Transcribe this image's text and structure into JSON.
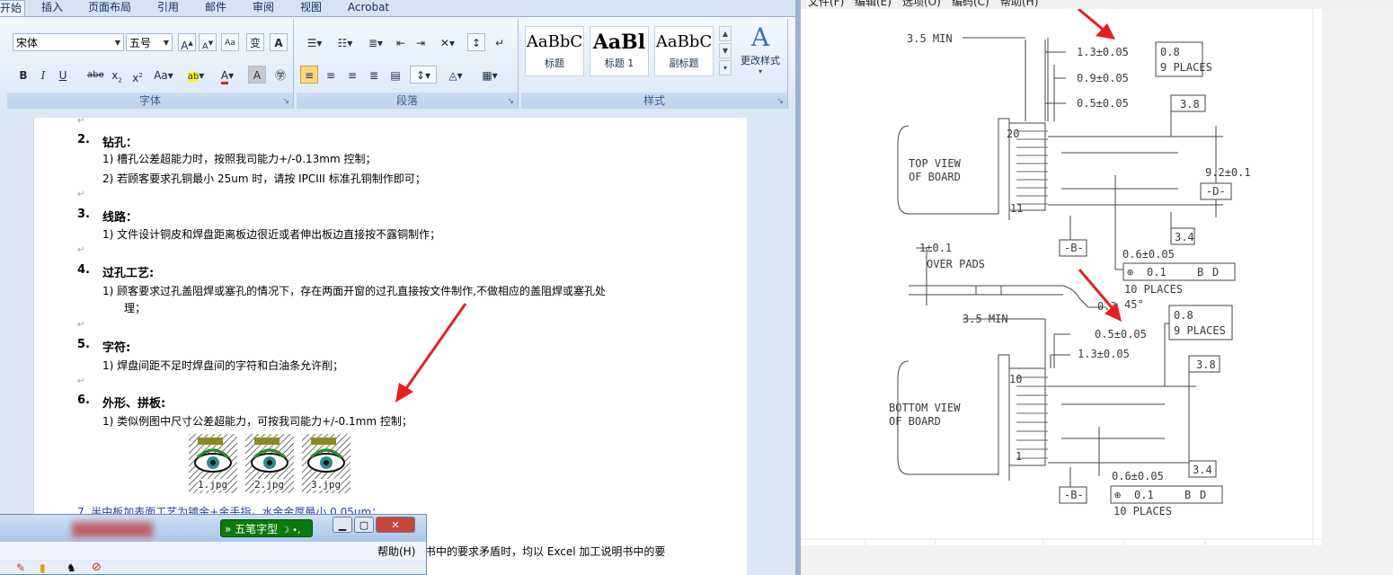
{
  "word": {
    "tabs": [
      "开始",
      "插入",
      "页面布局",
      "引用",
      "邮件",
      "审阅",
      "视图",
      "Acrobat"
    ],
    "font": {
      "name": "宋体",
      "size": "五号"
    },
    "groups": {
      "font": "字体",
      "paragraph": "段落",
      "styles": "样式"
    },
    "styles": [
      {
        "sample": "AaBbC",
        "name": "标题"
      },
      {
        "sample": "AaBl",
        "name": "标题 1"
      },
      {
        "sample": "AaBbC",
        "name": "副标题"
      }
    ],
    "change_styles": "更改样式",
    "doc": {
      "s2": {
        "num": "2.",
        "title": "钻孔："
      },
      "s2_i1": "1)  槽孔公差超能力时，按照我司能力+/-0.13mm 控制；",
      "s2_i2": "2)  若顾客要求孔铜最小 25um 时，请按 IPCIII 标准孔铜制作即可；",
      "s3": {
        "num": "3.",
        "title": "线路："
      },
      "s3_i1": "1)  文件设计铜皮和焊盘距离板边很近或者伸出板边直接按不露铜制作；",
      "s4": {
        "num": "4.",
        "title": "过孔工艺:"
      },
      "s4_i1a": "1)  顾客要求过孔盖阻焊或塞孔的情况下，存在两面开窗的过孔直接按文件制作,不做相应的盖阻焊或塞孔处",
      "s4_i1b": "理；",
      "s5": {
        "num": "5.",
        "title": "字符:"
      },
      "s5_i1": "1)  焊盘间距不足时焊盘间的字符和白油条允许削；",
      "s6": {
        "num": "6.",
        "title": "外形、拼板:"
      },
      "s6_i1": "1)  类似例图中尺寸公差超能力，可按我司能力+/-0.1mm 控制；",
      "files": [
        "1.jpg",
        "2.jpg",
        "3.jpg"
      ],
      "s7_partial": "7.  半中板加表面工艺为镀金+金手指，水金金厚最小 0.05um；",
      "tail": "书中的要求矛盾时，均以 Excel 加工说明书中的要"
    }
  },
  "mini_window": {
    "ime_label": "五笔字型",
    "ime_marks": "☽ •,",
    "menu_help": "帮助(H)"
  },
  "viewer": {
    "menu": [
      "文件(F)",
      "编辑(E)",
      "选项(O)",
      "编码(C)",
      "帮助(H)"
    ],
    "drawing": {
      "top": {
        "min": "3.5 MIN",
        "d1": "1.3±0.05",
        "d2": "0.9±0.05",
        "d3": "0.5±0.05",
        "places": [
          "0.8",
          "9 PLACES"
        ],
        "box38": "3.8",
        "view": [
          "TOP VIEW",
          "OF BOARD"
        ],
        "pin20": "20",
        "pin11": "11",
        "width": "9.2±0.1",
        "datumD": "-D-",
        "box34": "3.4",
        "datumB": "-B-",
        "pad": "0.6±0.05",
        "tol": [
          "0.1",
          "B",
          "D"
        ],
        "tenplaces": "10 PLACES"
      },
      "side": {
        "thick": "1±0.1",
        "over": "OVER PADS",
        "chamfer": "0.3",
        "angle": "45°"
      },
      "bottom": {
        "min": "3.5 MIN",
        "d1": "0.5±0.05",
        "d2": "1.3±0.05",
        "places": [
          "0.8",
          "9 PLACES"
        ],
        "box38": "3.8",
        "view": [
          "BOTTOM VIEW",
          "OF BOARD"
        ],
        "pin10": "10",
        "pin1": "1",
        "box34": "3.4",
        "pad": "0.6±0.05",
        "datumB": "-B-",
        "tol": [
          "0.1",
          "B",
          "D"
        ],
        "tenplaces": "10 PLACES"
      }
    }
  },
  "colors": {
    "arrow": "#e52020",
    "ribbon": "#dbe7f6",
    "ime": "#0b7a0b"
  }
}
